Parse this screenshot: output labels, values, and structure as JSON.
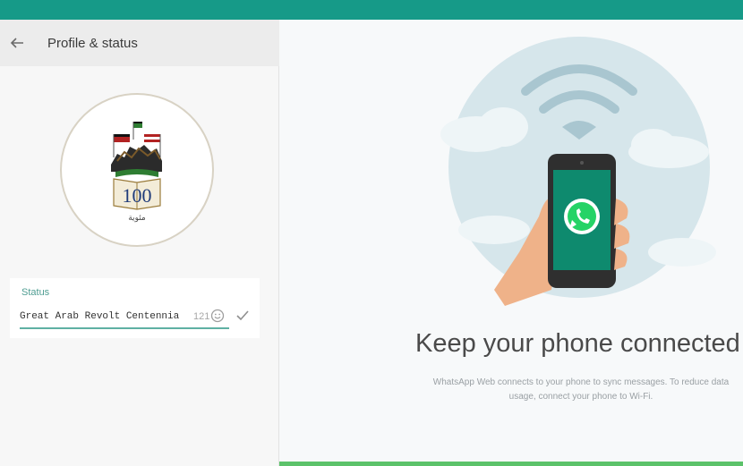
{
  "header": {
    "title": "Profile & status"
  },
  "avatar": {
    "badge_number": "100",
    "badge_caption": "مئوية"
  },
  "status": {
    "label": "Status",
    "value": "Great Arab Revolt Centennia",
    "char_count": "121"
  },
  "main": {
    "title": "Keep your phone connected",
    "description": "WhatsApp Web connects to your phone to sync messages. To reduce data usage, connect your phone to Wi-Fi."
  },
  "colors": {
    "top_bar": "#169a88",
    "accent": "#5fb0a3",
    "bottom_bar": "#5cc26a",
    "whatsapp_green": "#25d366"
  }
}
